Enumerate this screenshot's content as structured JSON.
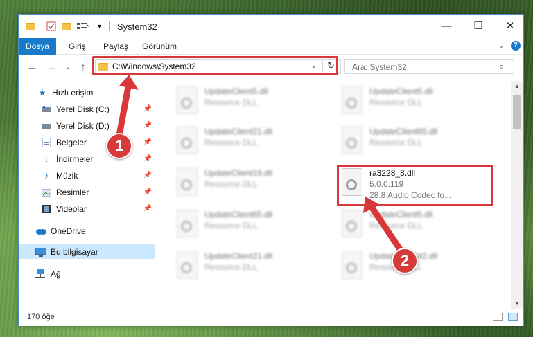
{
  "window": {
    "title": "System32"
  },
  "menu": {
    "file": "Dosya",
    "home": "Giriş",
    "share": "Paylaş",
    "view": "Görünüm"
  },
  "address": {
    "path": "C:\\Windows\\System32"
  },
  "search": {
    "placeholder": "Ara: System32"
  },
  "sidebar": {
    "items": [
      {
        "label": "Hızlı erişim",
        "icon": "star-icon"
      },
      {
        "label": "Yerel Disk (C:)",
        "icon": "drive-icon",
        "pinned": true
      },
      {
        "label": "Yerel Disk (D:)",
        "icon": "drive-icon",
        "pinned": true
      },
      {
        "label": "Belgeler",
        "icon": "documents-icon",
        "pinned": true
      },
      {
        "label": "İndirmeler",
        "icon": "download-icon",
        "pinned": true
      },
      {
        "label": "Müzik",
        "icon": "music-icon",
        "pinned": true
      },
      {
        "label": "Resimler",
        "icon": "pictures-icon",
        "pinned": true
      },
      {
        "label": "Videolar",
        "icon": "videos-icon",
        "pinned": true
      },
      {
        "label": "OneDrive",
        "icon": "cloud-icon"
      },
      {
        "label": "Bu bilgisayar",
        "icon": "computer-icon",
        "selected": true
      },
      {
        "label": "Ağ",
        "icon": "network-icon"
      }
    ]
  },
  "files": [
    {
      "name": "UpdateClient5.dll",
      "desc": "Resource DLL"
    },
    {
      "name": "UpdateClient5.dll",
      "desc": "Resource DLL"
    },
    {
      "name": "UpdateClient21.dll",
      "desc": "Resource DLL"
    },
    {
      "name": "UpdateClient65.dll",
      "desc": "Resource DLL"
    },
    {
      "name": "UpdateClient19.dll",
      "desc": "Resource DLL"
    },
    {
      "name": "ra3228_8.dll",
      "version": "5.0.0.119",
      "desc": "28.8 Audio Codec fo...",
      "highlighted": true
    },
    {
      "name": "UpdateClient65.dll",
      "desc": "Resource DLL"
    },
    {
      "name": "UpdateClient5.dll",
      "desc": "Resource DLL"
    },
    {
      "name": "UpdateClient21.dll",
      "desc": "Resource DLL"
    },
    {
      "name": "UpdateClient42.dll",
      "desc": "Resource DLL"
    }
  ],
  "status": {
    "count": "170 öğe"
  },
  "annotations": {
    "step1": "1",
    "step2": "2",
    "color": "#d9383b"
  }
}
